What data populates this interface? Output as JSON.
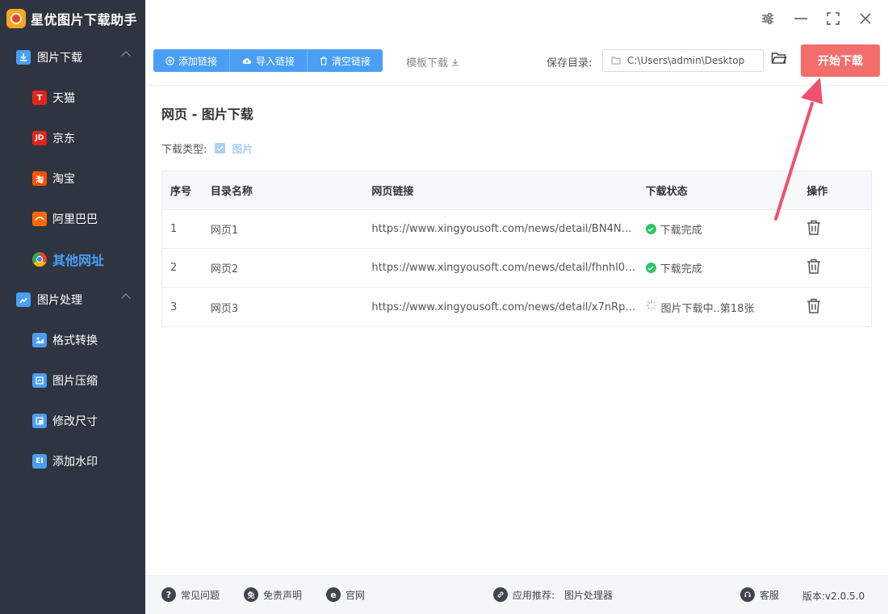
{
  "app": {
    "title": "星优图片下载助手"
  },
  "sidebar": {
    "groups": [
      {
        "label": "图片下载",
        "items": [
          {
            "label": "天猫",
            "icon_text": "T",
            "color": "#e1251b"
          },
          {
            "label": "京东",
            "icon_text": "JD",
            "color": "#e1251b"
          },
          {
            "label": "淘宝",
            "icon_text": "淘",
            "color": "#ff5000"
          },
          {
            "label": "阿里巴巴",
            "icon_text": "",
            "color": "#ff6a00"
          },
          {
            "label": "其他网址",
            "icon_text": "",
            "color": "#4a9ff5",
            "active": true
          }
        ]
      },
      {
        "label": "图片处理",
        "items": [
          {
            "label": "格式转换",
            "icon_text": "",
            "color": "#4a9ff5"
          },
          {
            "label": "图片压缩",
            "icon_text": "",
            "color": "#4a9ff5"
          },
          {
            "label": "修改尺寸",
            "icon_text": "",
            "color": "#4a9ff5"
          },
          {
            "label": "添加水印",
            "icon_text": "EI",
            "color": "#4a9ff5"
          }
        ]
      }
    ]
  },
  "toolbar": {
    "add_link": "添加链接",
    "import_link": "导入链接",
    "clear_link": "清空链接",
    "template": "模板下载",
    "save_label": "保存目录:",
    "save_path": "C:\\Users\\admin\\Desktop",
    "start": "开始下载"
  },
  "main": {
    "title": "网页 - 图片下载",
    "download_type_label": "下载类型:",
    "download_type_option": "图片",
    "table": {
      "headers": [
        "序号",
        "目录名称",
        "网页链接",
        "下载状态",
        "操作"
      ],
      "rows": [
        {
          "index": "1",
          "name": "网页1",
          "url": "https://www.xingyousoft.com/news/detail/BN4N…",
          "status": "下载完成",
          "state": "done"
        },
        {
          "index": "2",
          "name": "网页2",
          "url": "https://www.xingyousoft.com/news/detail/fhnhl0…",
          "status": "下载完成",
          "state": "done"
        },
        {
          "index": "3",
          "name": "网页3",
          "url": "https://www.xingyousoft.com/news/detail/x7nRp…",
          "status": "图片下载中..第18张",
          "state": "loading"
        }
      ]
    }
  },
  "footer": {
    "faq": "常见问题",
    "disclaimer": "免责声明",
    "website": "官网",
    "recommend_label": "应用推荐:",
    "recommend_app": "图片处理器",
    "support": "客服",
    "version": "版本:v2.0.5.0"
  },
  "colors": {
    "accent": "#4a9ff5",
    "start": "#f36d6b",
    "sidebar": "#2f3441",
    "arrow": "#f0506e"
  }
}
